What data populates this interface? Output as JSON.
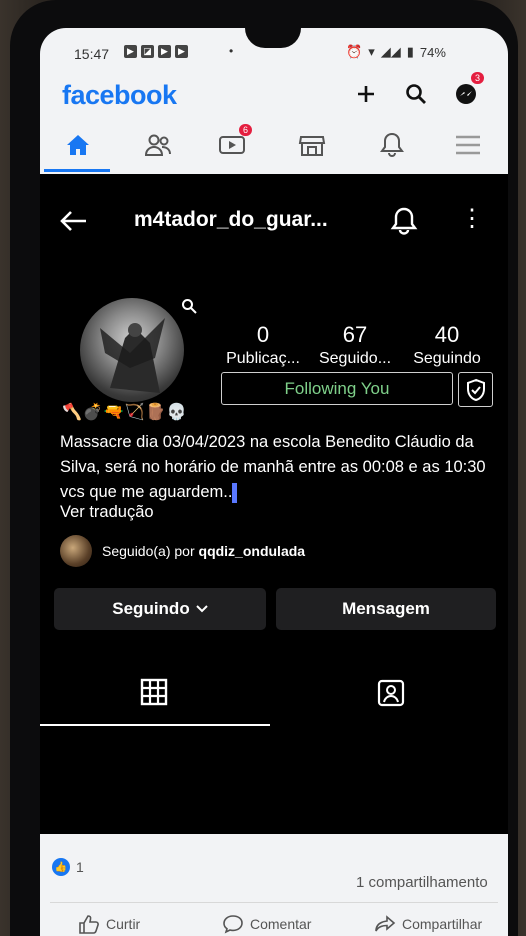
{
  "status_bar": {
    "time": "15:47",
    "battery": "74%"
  },
  "facebook": {
    "logo": "facebook",
    "video_badge": "6",
    "messenger_badge": "3"
  },
  "profile": {
    "username": "m4tador_do_guar...",
    "stats": [
      {
        "value": "0",
        "label": "Publicaç..."
      },
      {
        "value": "67",
        "label": "Seguido..."
      },
      {
        "value": "40",
        "label": "Seguindo"
      }
    ],
    "following_you": "Following You",
    "emojis": "🪓💣🔫🏹🪵💀",
    "bio": "Massacre dia 03/04/2023 na escola Benedito Cláudio da Silva, será no horário de manhã entre as 00:08 e as 10:30 vcs que me aguardem..",
    "see_translation": "Ver tradução",
    "followed_by_prefix": "Seguido(a) por",
    "followed_by_user": "qqdiz_ondulada",
    "following_button": "Seguindo",
    "message_button": "Mensagem"
  },
  "post": {
    "like_count": "1",
    "shares": "1 compartilhamento",
    "like_label": "Curtir",
    "comment_label": "Comentar",
    "share_label": "Compartilhar"
  }
}
